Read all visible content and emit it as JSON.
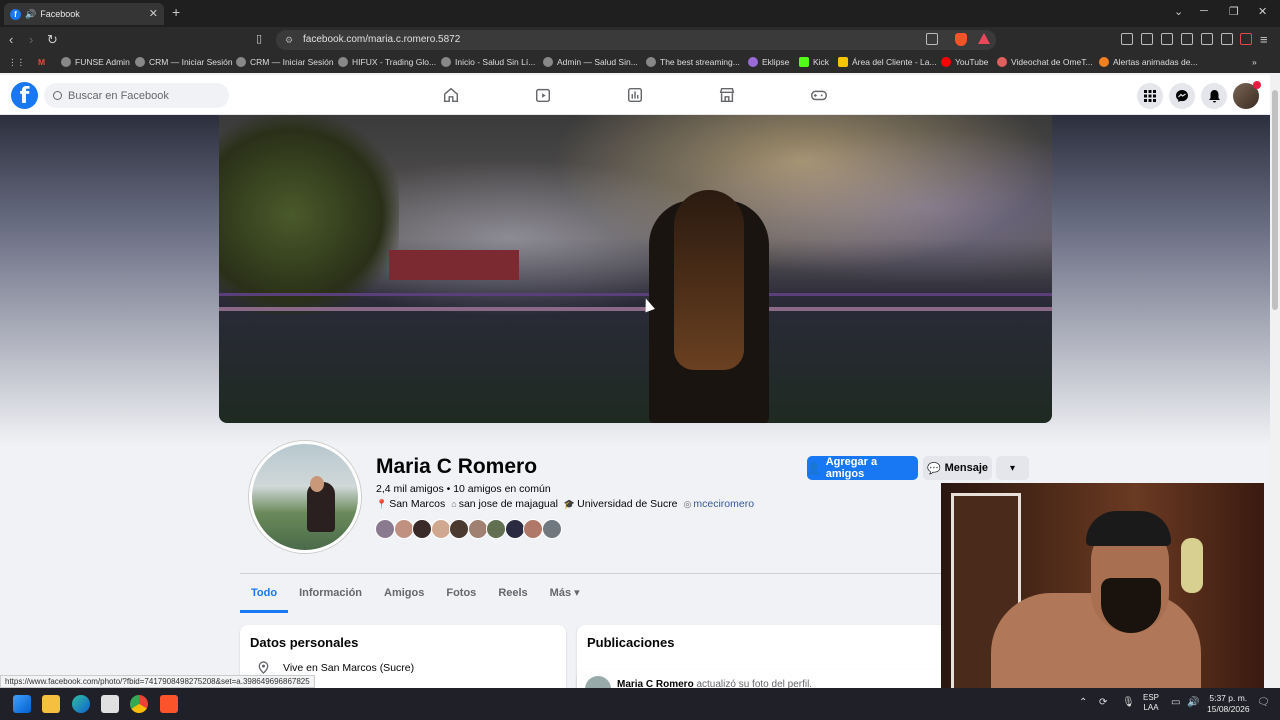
{
  "browser": {
    "tab_title": "Facebook",
    "url": "facebook.com/maria.c.romero.5872",
    "bookmarks": [
      "FUNSE Admin",
      "CRM — Iniciar Sesión",
      "CRM — Iniciar Sesión",
      "HIFUX - Trading Glo...",
      "Inicio - Salud Sin Lí...",
      "Admin — Salud Sin...",
      "The best streaming...",
      "Eklipse",
      "Kick",
      "Área del Cliente - La...",
      "YouTube",
      "Videochat de OmeT...",
      "Alertas animadas de..."
    ]
  },
  "fb": {
    "search_placeholder": "Buscar en Facebook"
  },
  "profile": {
    "name": "Maria C Romero",
    "friends": "2,4 mil amigos • 10 amigos en común",
    "location": "San Marcos",
    "hometown": "san jose de majagual",
    "education": "Universidad de Sucre",
    "instagram": "mceciromero",
    "add_friend": "Agregar a amigos",
    "message": "Mensaje",
    "tabs": [
      "Todo",
      "Información",
      "Amigos",
      "Fotos",
      "Reels",
      "Más"
    ]
  },
  "personal": {
    "title": "Datos personales",
    "lives": "Vive en San Marcos (Sucre)"
  },
  "posts": {
    "title": "Publicaciones",
    "author": "Maria C Romero",
    "action": "actualizó su foto del perfil."
  },
  "status_url": "https://www.facebook.com/photo/?fbid=741790849827520​8&set=a.398649696867825",
  "taskbar": {
    "lang_top": "ESP",
    "lang_bottom": "LAA",
    "time": "5:37 p. m.",
    "date": "15/08/2026"
  },
  "colors": {
    "fb_blue": "#1877f2",
    "text": "#050505",
    "muted": "#65676b"
  }
}
